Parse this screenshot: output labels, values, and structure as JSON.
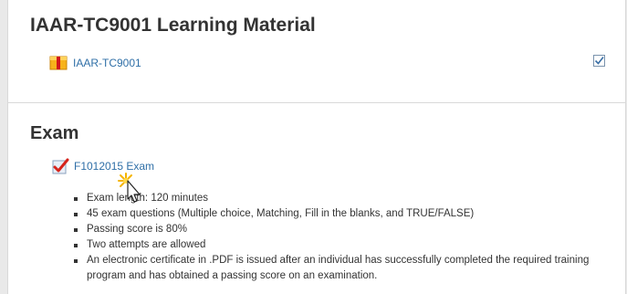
{
  "learning_section": {
    "title": "IAAR-TC9001 Learning Material",
    "activity_label": "IAAR-TC9001",
    "activity_icon": "package-icon",
    "completion_icon": "completion-checkbox-icon"
  },
  "exam_section": {
    "title": "Exam",
    "activity_label": "F1012015 Exam",
    "activity_icon": "quiz-check-icon",
    "details": [
      "Exam length: 120 minutes",
      "45 exam questions (Multiple choice, Matching, Fill in the blanks, and TRUE/FALSE)",
      "Passing score is 80%",
      "Two attempts are allowed",
      "An electronic certificate in .PDF is issued after an individual has successfully completed the required training program and has obtained a passing score on an examination."
    ]
  },
  "colors": {
    "link": "#2f6fa7",
    "text": "#333333",
    "background": "#e9e9e9",
    "panel": "#ffffff"
  }
}
